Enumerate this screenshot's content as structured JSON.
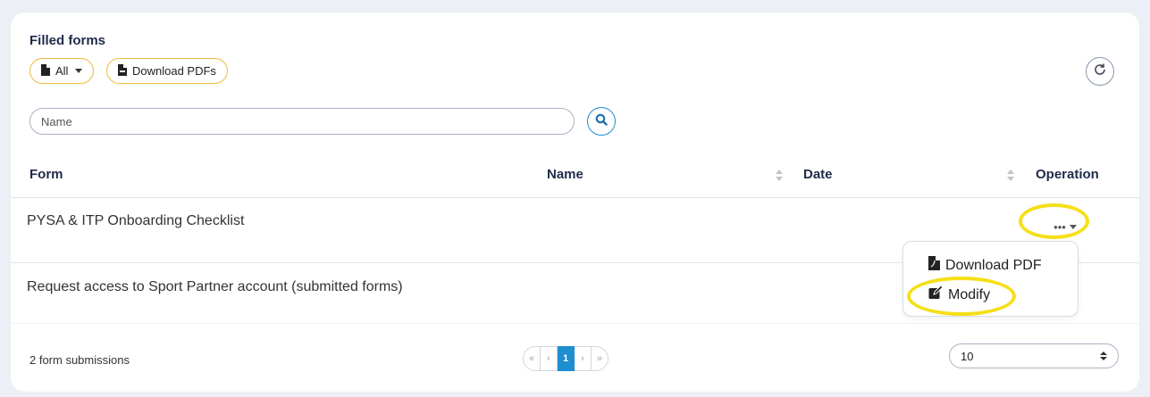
{
  "card": {
    "title": "Filled forms",
    "filter_label": "All",
    "download_pdfs_label": "Download PDFs"
  },
  "search": {
    "placeholder": "Name",
    "value": ""
  },
  "table": {
    "columns": [
      "Form",
      "Name",
      "Date",
      "Operation"
    ],
    "rows": [
      {
        "form": "PYSA & ITP Onboarding Checklist",
        "name": "",
        "date": ""
      },
      {
        "form": "Request access to Sport Partner account (submitted forms)",
        "name": "",
        "date": ""
      }
    ],
    "operation_button": "•••"
  },
  "dropdown": {
    "items": [
      "Download PDF",
      "Modify"
    ]
  },
  "footer": {
    "count_text": "2 form submissions",
    "pagination": [
      "«",
      "‹",
      "1",
      "›",
      "»"
    ],
    "active_page": "1",
    "page_size": "10"
  },
  "colors": {
    "accent_blue": "#1e8ed1",
    "pill_border": "#f0b93b",
    "highlight": "#f5df17",
    "heading": "#1f2b48"
  },
  "icons": [
    "file-icon",
    "file-pdf-icon",
    "refresh-icon",
    "search-icon",
    "edit-icon",
    "sort-icon",
    "caret-down-icon"
  ]
}
